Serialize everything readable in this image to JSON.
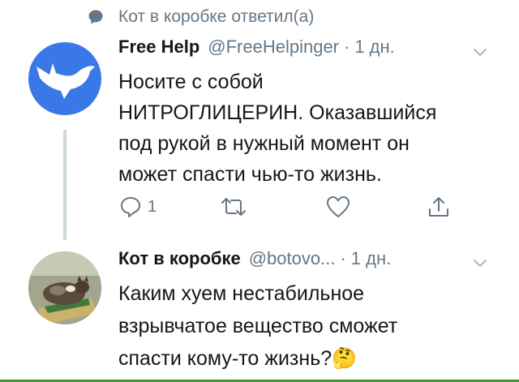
{
  "reply_context": {
    "text": "Кот в коробке ответил(а)",
    "icon": "speech-bubble-icon"
  },
  "tweets": [
    {
      "author_name": "Free Help",
      "handle": "@FreeHelpinger",
      "separator": "·",
      "time": "1 дн.",
      "avatar": "white-bird-on-blue-avatar",
      "lines": [
        "Носите с собой",
        "НИТРОГЛИЦЕРИН. Оказавшийся",
        "под рукой в нужный момент он",
        "может спасти чью-то жизнь."
      ],
      "reply_count": "1"
    },
    {
      "author_name": "Кот в коробке",
      "handle": "@botovo...",
      "separator": "·",
      "time": "1 дн.",
      "avatar": "cat-in-box-avatar",
      "lines": [
        "Каким хуем нестабильное",
        "взрывчатое вещество сможет",
        "спасти кому-то жизнь?"
      ],
      "emoji": "🤔"
    }
  ],
  "colors": {
    "secondary_text": "#657786",
    "primary_text": "#14171a",
    "thread_line": "#ccd6dd",
    "avatar_blue": "#3b78e7"
  }
}
